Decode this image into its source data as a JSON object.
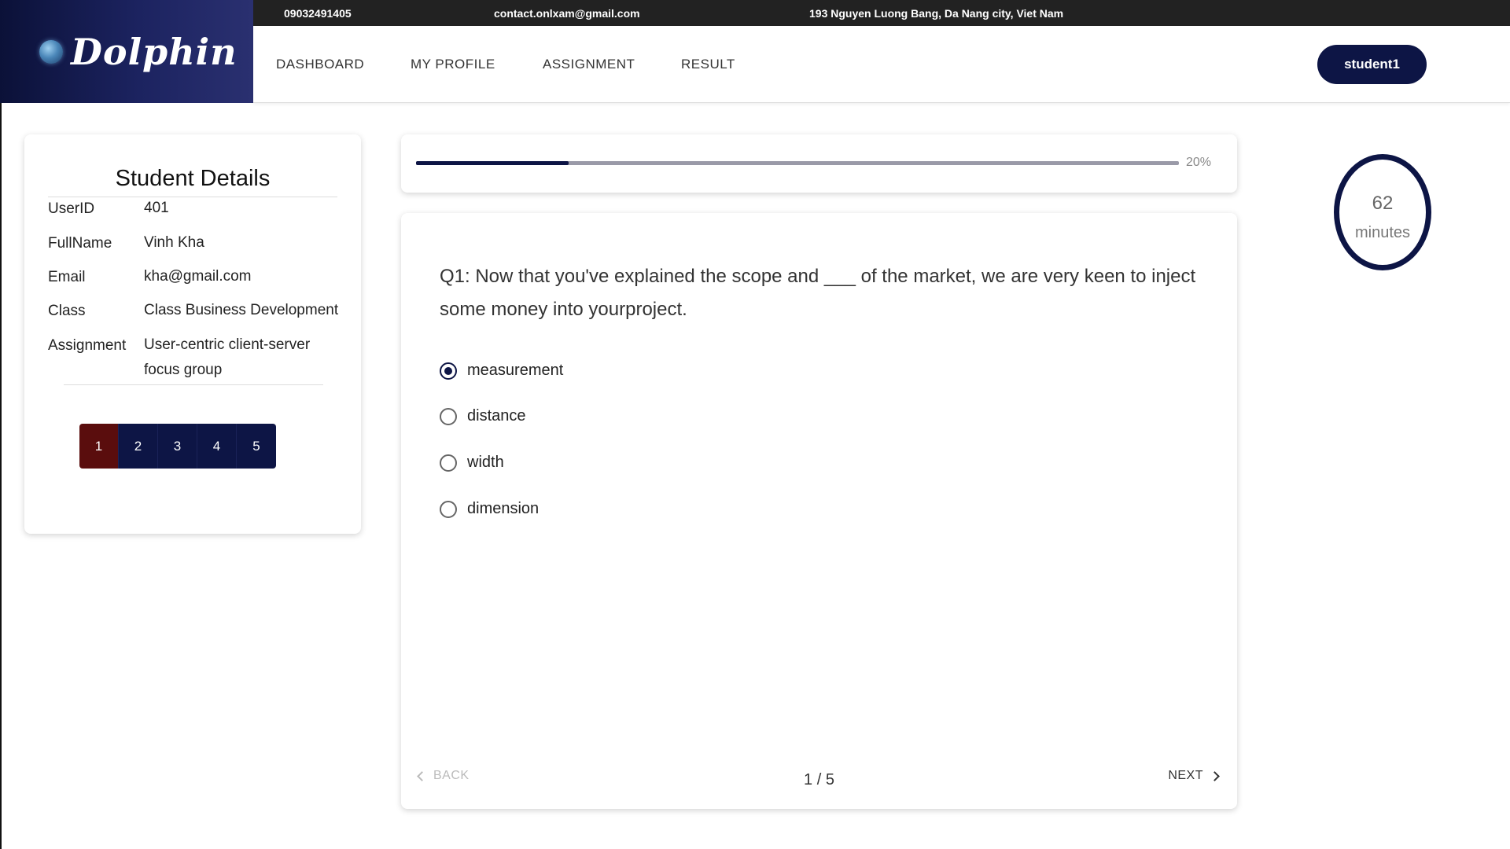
{
  "brand": {
    "name": "Dolphin",
    "logo_icon": "globe-icon"
  },
  "infobar": {
    "phone": "09032491405",
    "email": "contact.onlxam@gmail.com",
    "address": "193 Nguyen Luong Bang, Da Nang city, Viet Nam"
  },
  "nav": {
    "items": [
      {
        "label": "DASHBOARD"
      },
      {
        "label": "MY PROFILE"
      },
      {
        "label": "ASSIGNMENT"
      },
      {
        "label": "RESULT"
      }
    ],
    "user_button": "student1"
  },
  "student_details": {
    "title": "Student Details",
    "rows": [
      {
        "label": "UserID",
        "value": "401"
      },
      {
        "label": "FullName",
        "value": "Vinh Kha"
      },
      {
        "label": "Email",
        "value": "kha@gmail.com"
      },
      {
        "label": "Class",
        "value": "Class Business Development"
      },
      {
        "label": "Assignment",
        "value": "User-centric client-server focus group"
      }
    ],
    "question_buttons": [
      "1",
      "2",
      "3",
      "4",
      "5"
    ],
    "active_question": "1"
  },
  "progress": {
    "percent": 20,
    "label": "20%"
  },
  "question": {
    "text": "Q1: Now that you've explained the scope and ___ of the market, we are very keen to inject some money into yourproject.",
    "options": [
      {
        "label": "measurement",
        "selected": true
      },
      {
        "label": "distance",
        "selected": false
      },
      {
        "label": "width",
        "selected": false
      },
      {
        "label": "dimension",
        "selected": false
      }
    ],
    "back_label": "BACK",
    "next_label": "NEXT",
    "page_indicator": "1 / 5"
  },
  "timer": {
    "value": "62",
    "unit": "minutes"
  },
  "colors": {
    "primary": "#0d1545",
    "active_question": "#5a0d0d",
    "progress_track": "#9a9aa8"
  }
}
